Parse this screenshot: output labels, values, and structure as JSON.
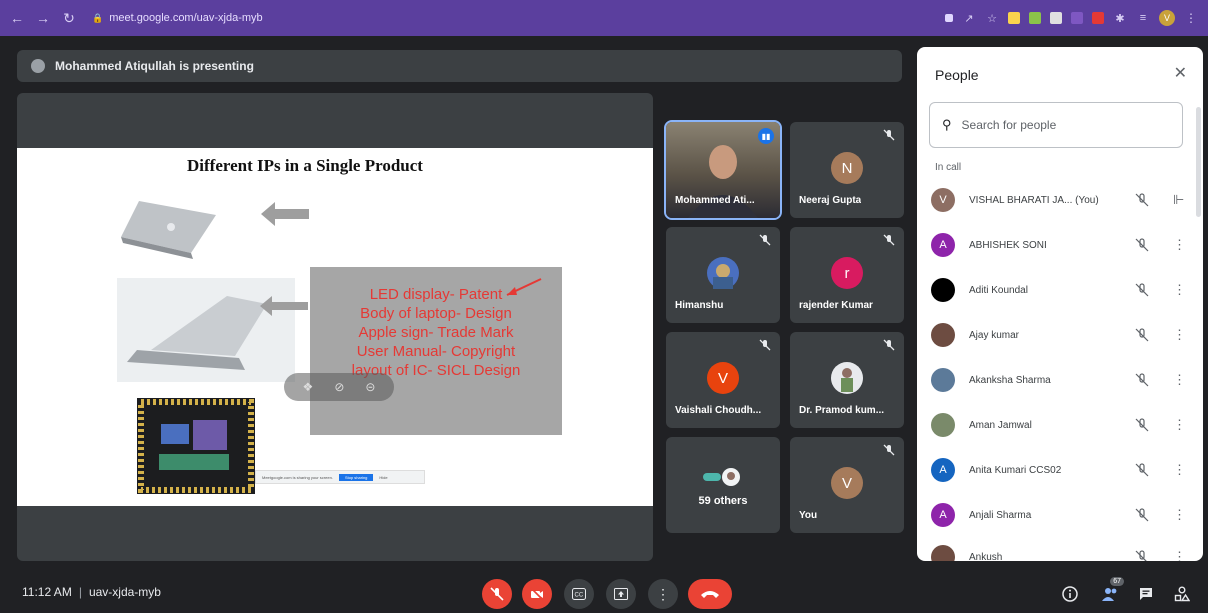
{
  "browser": {
    "url": "meet.google.com/uav-xjda-myb",
    "profile_initial": "V"
  },
  "banner": {
    "text": "Mohammed Atiqullah is presenting"
  },
  "slide": {
    "title": "Different IPs in a Single Product",
    "box_lines": [
      "LED display- Patent",
      "Body of laptop- Design",
      "Apple sign- Trade Mark",
      "User Manual- Copyright",
      "layout of IC- SICL Design"
    ],
    "share_bar": {
      "text": "Meetgoogle.com is sharing your screen.",
      "stop_label": "Stop sharing",
      "hide_label": "Hide"
    }
  },
  "tiles": [
    {
      "name": "Mohammed Ati...",
      "type": "camera"
    },
    {
      "name": "Neeraj Gupta",
      "initial": "N",
      "color": "#a67b5b"
    },
    {
      "name": "Himanshu",
      "type": "photo"
    },
    {
      "name": "rajender Kumar",
      "initial": "r",
      "color": "#d81b60"
    },
    {
      "name": "Vaishali Choudh...",
      "initial": "V",
      "color": "#e8430e"
    },
    {
      "name": "Dr. Pramod kum...",
      "type": "photo"
    },
    {
      "name": "59 others",
      "type": "others"
    },
    {
      "name": "You",
      "initial": "V",
      "color": "#a67b5b"
    }
  ],
  "people": {
    "title": "People",
    "search_placeholder": "Search for people",
    "section": "In call",
    "list": [
      {
        "name": "VISHAL BHARATI JA... (You)",
        "initial": "V",
        "color": "#8d6e63",
        "pin": true
      },
      {
        "name": "ABHISHEK SONI",
        "initial": "A",
        "color": "#8e24aa"
      },
      {
        "name": "Aditi Koundal",
        "initial": "",
        "color": "#000000"
      },
      {
        "name": "Ajay kumar",
        "initial": "",
        "color": "#6d4c41"
      },
      {
        "name": "Akanksha Sharma",
        "initial": "",
        "color": "#5c7a99"
      },
      {
        "name": "Aman Jamwal",
        "initial": "",
        "color": "#7a8a6a"
      },
      {
        "name": "Anita Kumari CCS02",
        "initial": "A",
        "color": "#1565c0"
      },
      {
        "name": "Anjali Sharma",
        "initial": "A",
        "color": "#8e24aa"
      },
      {
        "name": "Ankush",
        "initial": "",
        "color": "#6d4c41"
      }
    ]
  },
  "footer": {
    "time": "11:12 AM",
    "separator": "|",
    "meeting_code": "uav-xjda-myb",
    "participant_count": "67"
  }
}
